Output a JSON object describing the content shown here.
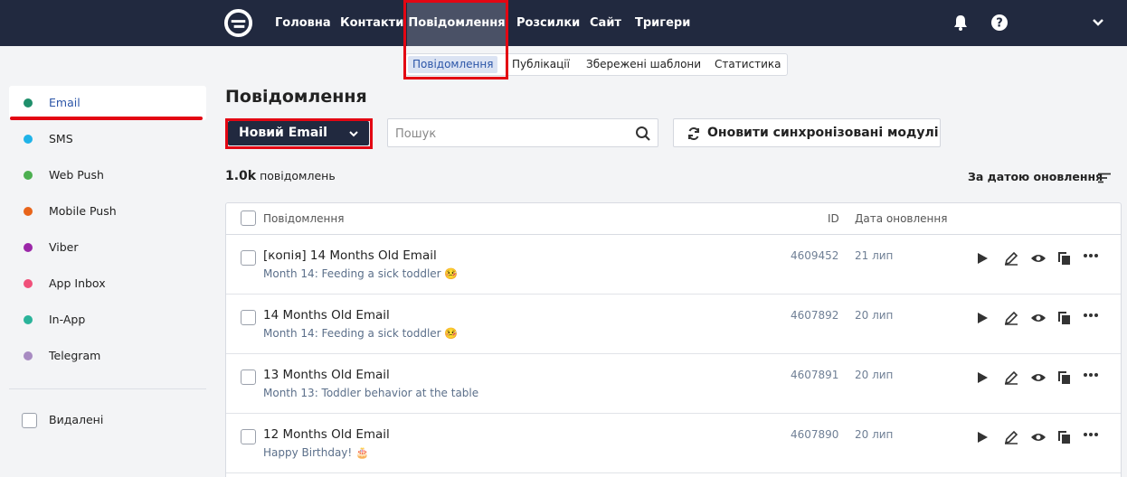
{
  "nav": {
    "items": [
      "Головна",
      "Контакти",
      "Повідомлення",
      "Розсилки",
      "Сайт",
      "Тригери"
    ],
    "active": "Повідомлення"
  },
  "subtabs": [
    "Повідомлення",
    "Публікації",
    "Збережені шаблони",
    "Статистика"
  ],
  "sidebar": {
    "items": [
      {
        "label": "Email",
        "color": "#1f8f6b"
      },
      {
        "label": "SMS",
        "color": "#1fb3e8"
      },
      {
        "label": "Web Push",
        "color": "#4caf50"
      },
      {
        "label": "Mobile Push",
        "color": "#e8641a"
      },
      {
        "label": "Viber",
        "color": "#9b27a8"
      },
      {
        "label": "App Inbox",
        "color": "#f0507a"
      },
      {
        "label": "In-App",
        "color": "#2ab39a"
      },
      {
        "label": "Telegram",
        "color": "#a88bc2"
      }
    ],
    "deleted_label": "Видалені"
  },
  "main": {
    "title": "Повідомлення",
    "new_button": "Новий Email",
    "search_placeholder": "Пошук",
    "sync_button": "Оновити синхронізовані модулі",
    "count_value": "1.0k",
    "count_label": "повідомлень",
    "sort_label": "За датою оновлення"
  },
  "table": {
    "headers": {
      "name": "Повідомлення",
      "id": "ID",
      "date": "Дата оновлення"
    },
    "rows": [
      {
        "name": "[копія] 14 Months Old Email",
        "subject": "Month 14: Feeding a sick toddler 🤒",
        "id": "4609452",
        "date": "21 лип"
      },
      {
        "name": "14 Months Old Email",
        "subject": "Month 14: Feeding a sick toddler 🤒",
        "id": "4607892",
        "date": "20 лип"
      },
      {
        "name": "13 Months Old Email",
        "subject": "Month 13: Toddler behavior at the table",
        "id": "4607891",
        "date": "20 лип"
      },
      {
        "name": "12 Months Old Email",
        "subject": "Happy Birthday! 🎂",
        "id": "4607890",
        "date": "20 лип"
      }
    ]
  },
  "colors": {
    "topbar": "#21293f",
    "highlight": "#e30613",
    "accent": "#2c56a8"
  }
}
